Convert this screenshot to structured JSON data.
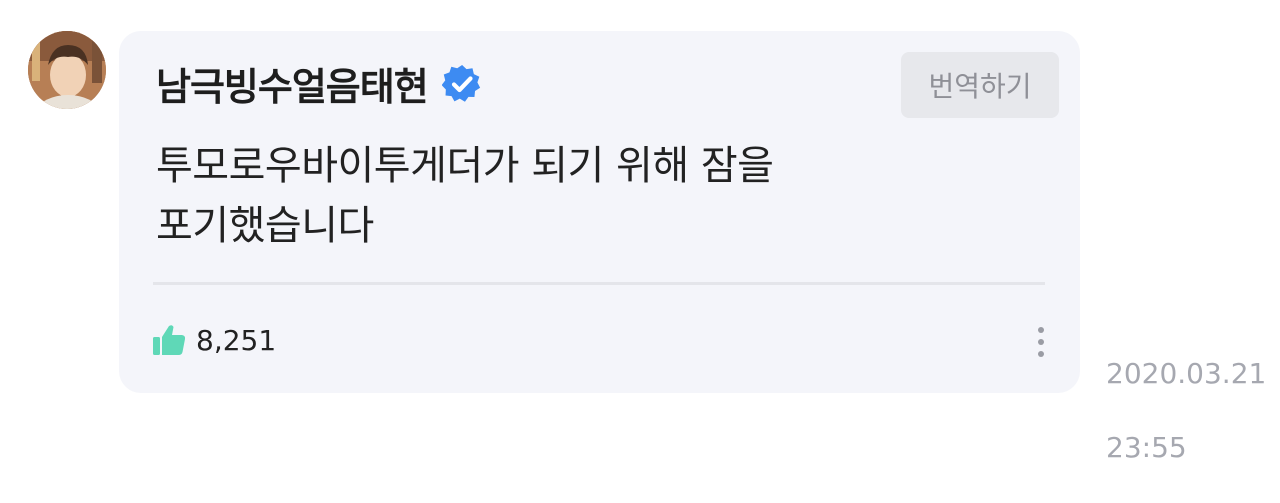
{
  "comment": {
    "author": "남극빙수얼음태현",
    "verified": true,
    "translate_label": "번역하기",
    "text": "투모로우바이투게더가 되기 위해 잠을\n포기했습니다",
    "likes": "8,251",
    "date": "2020.03.21",
    "time": "23:55"
  },
  "icons": {
    "verified": "verified-badge-icon",
    "like": "thumbs-up-icon",
    "more": "more-vertical-icon"
  },
  "colors": {
    "bubble": "#f4f5fa",
    "verified": "#3d8bf2",
    "like": "#5fd8b7",
    "timestamp": "#a6a8b0"
  }
}
